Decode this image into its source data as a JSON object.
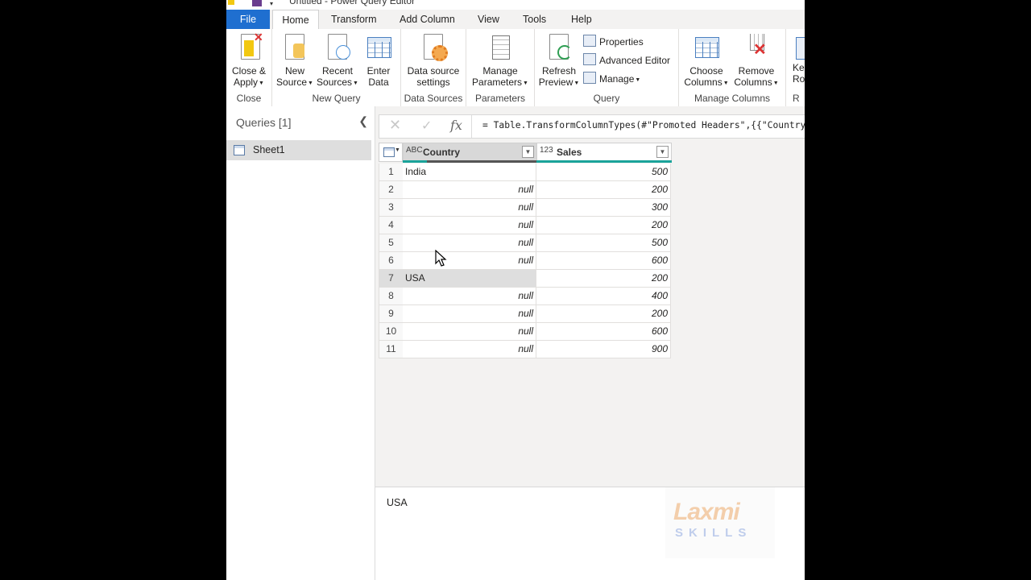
{
  "window": {
    "title": "Untitled - Power Query Editor"
  },
  "tabs": [
    "File",
    "Home",
    "Transform",
    "Add Column",
    "View",
    "Tools",
    "Help"
  ],
  "ribbon": {
    "close_group": {
      "label": "Close",
      "close_apply": [
        "Close &",
        "Apply"
      ]
    },
    "new_query_group": {
      "label": "New Query",
      "new_source": [
        "New",
        "Source"
      ],
      "recent_sources": [
        "Recent",
        "Sources"
      ],
      "enter_data": [
        "Enter",
        "Data"
      ]
    },
    "data_sources_group": {
      "label": "Data Sources",
      "data_source_settings": [
        "Data source",
        "settings"
      ]
    },
    "parameters_group": {
      "label": "Parameters",
      "manage_parameters": [
        "Manage",
        "Parameters"
      ]
    },
    "query_group": {
      "label": "Query",
      "refresh_preview": [
        "Refresh",
        "Preview"
      ],
      "properties": "Properties",
      "advanced_editor": "Advanced Editor",
      "manage": "Manage"
    },
    "manage_columns_group": {
      "label": "Manage Columns",
      "choose_columns": [
        "Choose",
        "Columns"
      ],
      "remove_columns": [
        "Remove",
        "Columns"
      ]
    },
    "reduce_rows_partial": {
      "label": "R",
      "keep_rows": [
        "Ke",
        "Ro"
      ]
    }
  },
  "queries_pane": {
    "header": "Queries [1]",
    "items": [
      "Sheet1"
    ]
  },
  "formula_bar": {
    "formula": "= Table.TransformColumnTypes(#\"Promoted Headers\",{{\"Country\""
  },
  "table": {
    "columns": [
      {
        "type_icon": "ABC",
        "name": "Country"
      },
      {
        "type_icon": "123",
        "name": "Sales"
      }
    ],
    "rows": [
      {
        "n": "1",
        "country": "India",
        "sales": "500"
      },
      {
        "n": "2",
        "country": "null",
        "sales": "200"
      },
      {
        "n": "3",
        "country": "null",
        "sales": "300"
      },
      {
        "n": "4",
        "country": "null",
        "sales": "200"
      },
      {
        "n": "5",
        "country": "null",
        "sales": "500"
      },
      {
        "n": "6",
        "country": "null",
        "sales": "600"
      },
      {
        "n": "7",
        "country": "USA",
        "sales": "200"
      },
      {
        "n": "8",
        "country": "null",
        "sales": "400"
      },
      {
        "n": "9",
        "country": "null",
        "sales": "200"
      },
      {
        "n": "10",
        "country": "null",
        "sales": "600"
      },
      {
        "n": "11",
        "country": "null",
        "sales": "900"
      }
    ]
  },
  "cell_preview": {
    "value": "USA"
  },
  "watermark": {
    "line1": "Laxmi",
    "line2": "SKILLS"
  },
  "colors": {
    "file_tab": "#1f6fd0",
    "quality_bar": "#1aa39a",
    "selected": "#dedede"
  }
}
